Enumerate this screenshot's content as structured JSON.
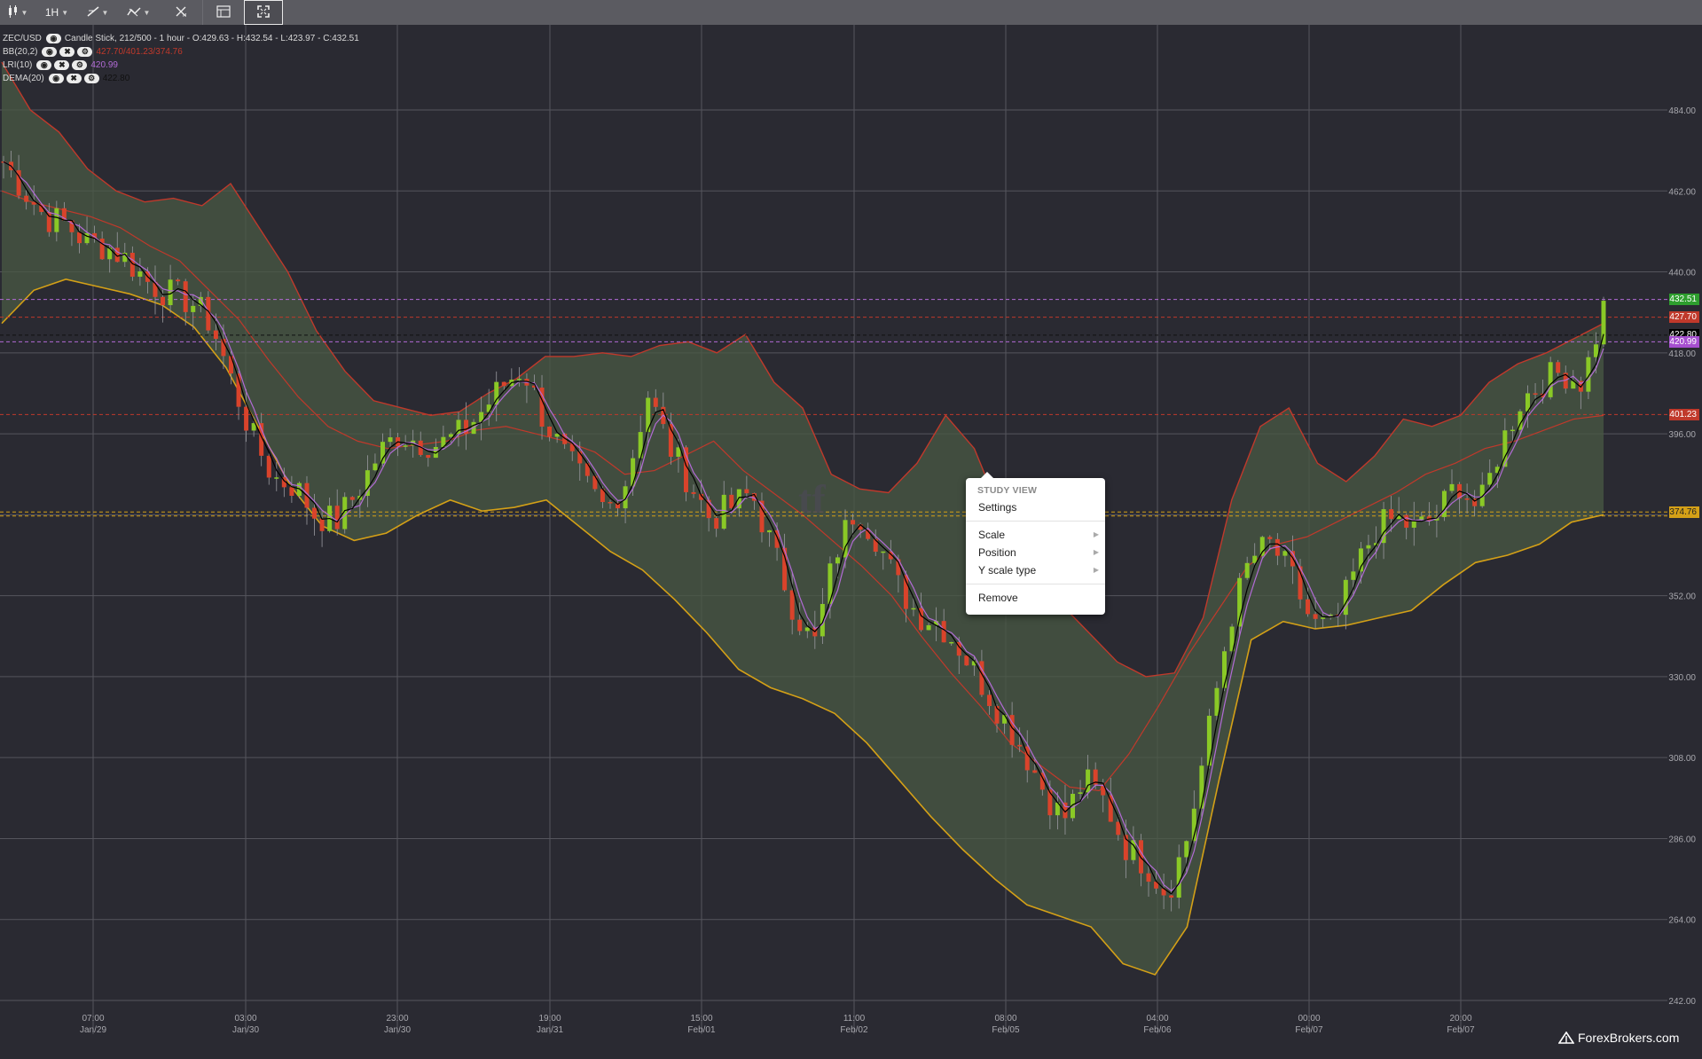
{
  "toolbar": {
    "candle_icon": "candlestick-icon",
    "interval": "1H",
    "draw_icon": "trendline-icon",
    "indicators_icon": "indicators-icon",
    "xy_icon": "crosshair-icon",
    "layout_icon": "layout-icon",
    "fullscreen_icon": "fullscreen-icon"
  },
  "legend": {
    "symbol": "ZEC/USD",
    "symbol_info": "Candle Stick, 212/500 - 1 hour - O:429.63 - H:432.54 - L:423.97 - C:432.51",
    "studies": [
      {
        "name": "BB(20,2)",
        "values": "427.70/401.23/374.76"
      },
      {
        "name": "LRI(10)",
        "values": "420.99"
      },
      {
        "name": "DEMA(20)",
        "values": "422.80"
      }
    ]
  },
  "colors": {
    "background": "#2a2a32",
    "up_candle": "#8ac926",
    "down_candle": "#d9432b",
    "bb_upper": "#c0392b",
    "bb_lower": "#d4a017",
    "bb_fill": "#4a5a44",
    "lri": "#b26bd6",
    "dema": "#000000"
  },
  "axis": {
    "y_ticks": [
      "484.00",
      "462.00",
      "440.00",
      "418.00",
      "396.00",
      "352.00",
      "330.00",
      "308.00",
      "286.00",
      "264.00",
      "242.00"
    ],
    "x_ticks": [
      {
        "time": "07:00",
        "date": "Jan/29"
      },
      {
        "time": "03:00",
        "date": "Jan/30"
      },
      {
        "time": "23:00",
        "date": "Jan/30"
      },
      {
        "time": "19:00",
        "date": "Jan/31"
      },
      {
        "time": "15:00",
        "date": "Feb/01"
      },
      {
        "time": "11:00",
        "date": "Feb/02"
      },
      {
        "time": "08:00",
        "date": "Feb/05"
      },
      {
        "time": "04:00",
        "date": "Feb/06"
      },
      {
        "time": "00:00",
        "date": "Feb/07"
      },
      {
        "time": "20:00",
        "date": "Feb/07"
      }
    ]
  },
  "price_tags": [
    {
      "label": "432.51",
      "bg": "#2e9e2e",
      "fg": "#ffffff"
    },
    {
      "label": "427.70",
      "bg": "#c0392b",
      "fg": "#ffffff"
    },
    {
      "label": "422.80",
      "bg": "#000000",
      "fg": "#ffffff"
    },
    {
      "label": "420.99",
      "bg": "#a64fd0",
      "fg": "#ffffff"
    },
    {
      "label": "401.23",
      "bg": "#c0392b",
      "fg": "#ffffff"
    },
    {
      "label": "374.76",
      "bg": "#d4a017",
      "fg": "#222222"
    }
  ],
  "context_menu": {
    "header": "STUDY VIEW",
    "settings": "Settings",
    "scale": "Scale",
    "position": "Position",
    "y_scale_type": "Y scale type",
    "remove": "Remove"
  },
  "watermark": "tf",
  "brand": "ForexBrokers.com",
  "chart_data": {
    "type": "candlestick",
    "symbol": "ZEC/USD",
    "ylim": [
      242,
      504
    ],
    "x_labels": [
      "07:00 Jan/29",
      "03:00 Jan/30",
      "23:00 Jan/30",
      "19:00 Jan/31",
      "15:00 Feb/01",
      "11:00 Feb/02",
      "08:00 Feb/05",
      "04:00 Feb/06",
      "00:00 Feb/07",
      "20:00 Feb/07"
    ],
    "close_path": [
      470,
      462,
      455,
      453,
      448,
      447,
      443,
      437,
      434,
      432,
      426,
      410,
      395,
      384,
      382,
      374,
      372,
      380,
      390,
      396,
      394,
      393,
      396,
      402,
      409,
      414,
      400,
      390,
      382,
      375,
      384,
      407,
      393,
      383,
      373,
      376,
      380,
      365,
      349,
      338,
      363,
      376,
      368,
      355,
      347,
      345,
      338,
      329,
      320,
      311,
      300,
      291,
      302,
      296,
      284,
      279,
      271,
      287,
      315,
      345,
      362,
      366,
      357,
      344,
      343,
      358,
      370,
      373,
      370,
      374,
      383,
      375,
      392,
      405,
      410,
      413,
      410,
      430
    ],
    "bb_upper": [
      497,
      484,
      478,
      468,
      462,
      459,
      460,
      458,
      464,
      452,
      440,
      424,
      413,
      405,
      403,
      401,
      402,
      407,
      411,
      417,
      417,
      418,
      417,
      420,
      421,
      418,
      423,
      410,
      403,
      385,
      381,
      380,
      388,
      401,
      392,
      373,
      365,
      350,
      342,
      334,
      330,
      331,
      346,
      378,
      398,
      403,
      388,
      383,
      390,
      400,
      398,
      401,
      410,
      415,
      418,
      422,
      426
    ],
    "bb_middle": [
      462,
      459,
      457,
      455,
      452,
      447,
      443,
      435,
      427,
      416,
      406,
      398,
      394,
      392,
      393,
      394,
      397,
      398,
      396,
      394,
      391,
      385,
      386,
      390,
      394,
      386,
      380,
      374,
      367,
      360,
      352,
      341,
      331,
      322,
      312,
      306,
      300,
      299,
      309,
      322,
      336,
      348,
      360,
      366,
      368,
      372,
      376,
      380,
      385,
      388,
      392,
      394,
      397,
      400,
      401
    ],
    "bb_lower": [
      426,
      435,
      438,
      436,
      434,
      431,
      425,
      414,
      398,
      382,
      371,
      367,
      369,
      374,
      378,
      375,
      376,
      378,
      371,
      364,
      359,
      351,
      342,
      332,
      327,
      324,
      320,
      312,
      302,
      292,
      283,
      275,
      268,
      265,
      262,
      252,
      249,
      262,
      302,
      340,
      345,
      343,
      344,
      346,
      348,
      355,
      361,
      363,
      366,
      372,
      374
    ],
    "lri_last": 420.99,
    "dema_last": 422.8,
    "bb_last": {
      "upper": 427.7,
      "middle": 401.23,
      "lower": 374.76
    },
    "last_close": 432.51
  }
}
